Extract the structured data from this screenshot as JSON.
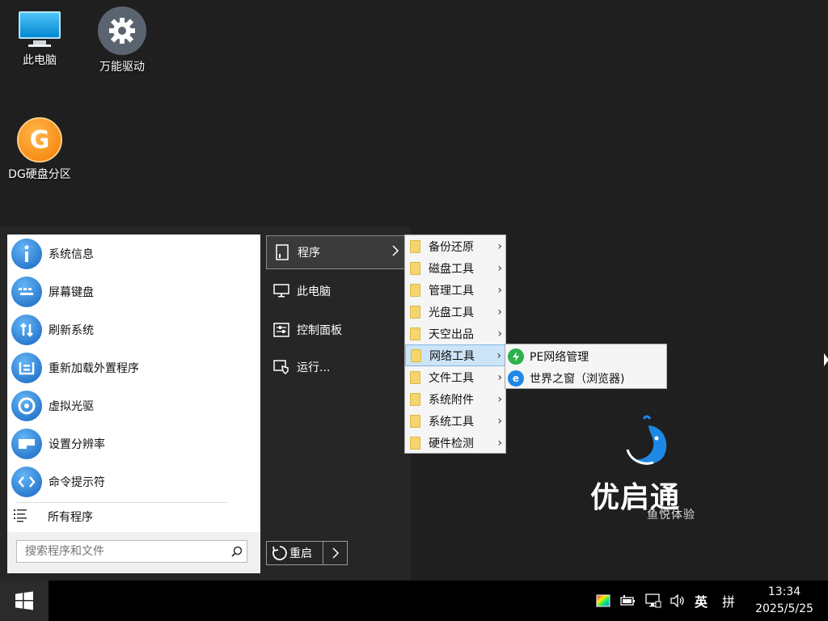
{
  "desktop": {
    "icons": [
      {
        "label": "此电脑",
        "icon": "monitor-icon"
      },
      {
        "label": "万能驱动",
        "icon": "gear-icon"
      },
      {
        "label": "DG硬盘分区",
        "icon": "dg-partition-icon"
      }
    ]
  },
  "start_menu": {
    "left_items": [
      {
        "label": "系统信息",
        "icon": "info-icon"
      },
      {
        "label": "屏幕键盘",
        "icon": "keyboard-icon"
      },
      {
        "label": "刷新系统",
        "icon": "refresh-icon"
      },
      {
        "label": "重新加载外置程序",
        "icon": "reload-icon"
      },
      {
        "label": "虚拟光驱",
        "icon": "disc-icon"
      },
      {
        "label": "设置分辨率",
        "icon": "resolution-icon"
      },
      {
        "label": "命令提示符",
        "icon": "command-icon"
      }
    ],
    "all_programs": "所有程序",
    "search_placeholder": "搜索程序和文件",
    "middle_items": [
      {
        "label": "程序",
        "icon": "program-icon"
      },
      {
        "label": "此电脑",
        "icon": "computer-icon"
      },
      {
        "label": "控制面板",
        "icon": "control-panel-icon"
      },
      {
        "label": "运行...",
        "icon": "run-icon"
      }
    ],
    "restart_label": "重启"
  },
  "programs_submenu": {
    "items": [
      "备份还原",
      "磁盘工具",
      "管理工具",
      "光盘工具",
      "天空出品",
      "网络工具",
      "文件工具",
      "系统附件",
      "系统工具",
      "硬件检测"
    ],
    "highlighted": "网络工具"
  },
  "network_submenu": {
    "items": [
      {
        "label": "PE网络管理",
        "icon": "network-manager-icon",
        "color": "#2bb24c"
      },
      {
        "label": "世界之窗（浏览器)",
        "icon": "browser-icon",
        "color": "#1e88e5"
      }
    ]
  },
  "logo": {
    "title": "优启通",
    "subtitle": "鱼悦体验",
    "accent": "#1e88e5"
  },
  "taskbar": {
    "ime_lang": "英",
    "ime_mode": "拼",
    "time": "13:34",
    "date": "2025/5/25"
  }
}
